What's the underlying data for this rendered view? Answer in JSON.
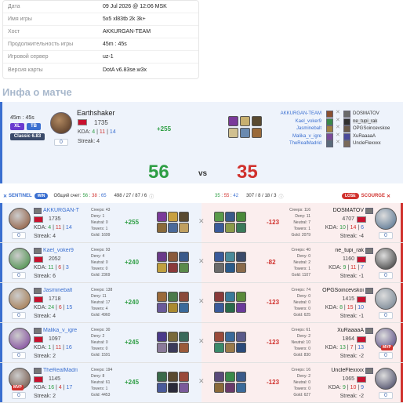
{
  "info": {
    "rows": [
      {
        "key": "Дата",
        "value": "09 Jul 2026 @ 12:06 MSK"
      },
      {
        "key": "Имя игры",
        "value": "5x5 xl83tb 2k 3k+"
      },
      {
        "key": "Хост",
        "value": "AKKURGAN-TEAM"
      },
      {
        "key": "Продолжительность игры",
        "value": "45m : 45s"
      },
      {
        "key": "Игровой сервер",
        "value": "uz-1"
      },
      {
        "key": "Версия карты",
        "value": "DotA v6.83se.w3x"
      }
    ]
  },
  "section_title": "Инфа о матче",
  "match": {
    "duration": "45m : 45s",
    "mode_xl": "XL",
    "mode_tb": "TB",
    "version": "Classic 6.83",
    "host_level": "0",
    "host_name": "Earthshaker",
    "host_rating": "1735",
    "host_kda_label": "KDA:",
    "host_kda_k": "4",
    "host_kda_d": "11",
    "host_kda_a": "14",
    "host_streak": "Streak: 4",
    "host_diff": "+255",
    "score_sentinel": "56",
    "vs": "vs",
    "score_scourge": "35",
    "team_left": [
      "AKKURGAN-TEAM",
      "Kael_voker9",
      "Jasminebalt",
      "Malika_v_igre",
      "TheRealMadrid"
    ],
    "team_right": [
      "DOSMATOV",
      "ne_tupi_rak",
      "OPGSoincevskoe",
      "XuRaaaaA",
      "UncleFlexxxx"
    ]
  },
  "team_header": {
    "sentinel": "SENTINEL",
    "win": "WIN",
    "total_label": "Общий счет:",
    "total_k": "56",
    "total_d": "38",
    "total_a": "65",
    "left_extra": "498 / 27 / 87 / 6",
    "right_score_k": "35",
    "right_score_d": "55",
    "right_score_a": "42",
    "right_extra": "307 / 8 / 18 / 3",
    "lose": "LOSE",
    "scourge": "SCOURGE"
  },
  "players": [
    {
      "left": {
        "name": "AKKURGAN-T",
        "rating": "1735",
        "k": "4",
        "d": "11",
        "a": "14",
        "streak": "Streak: 4",
        "level": "0",
        "creeps": "Creeps: 43",
        "deny": "Deny: 1",
        "neutral": "Neutral: 0",
        "towers": "Towers: 1",
        "gold": "Gold: 1699",
        "diff": "+255",
        "mvp": ""
      },
      "right": {
        "name": "DOSMATOV",
        "rating": "4707",
        "k": "10",
        "d": "14",
        "a": "6",
        "streak": "Streak: -4",
        "level": "0",
        "creeps": "Creeps: 116",
        "deny": "Deny: 11",
        "neutral": "Neutral: 7",
        "towers": "Towers: 1",
        "gold": "Gold: 2079",
        "diff": "-123",
        "mvp": ""
      }
    },
    {
      "left": {
        "name": "Kael_voker9",
        "rating": "2052",
        "k": "11",
        "d": "6",
        "a": "3",
        "streak": "Streak: 6",
        "level": "0",
        "creeps": "Creeps: 93",
        "deny": "Deny: 4",
        "neutral": "Neutral: 0",
        "towers": "Towers: 0",
        "gold": "Gold: 2369",
        "diff": "+240",
        "mvp": ""
      },
      "right": {
        "name": "ne_tupi_rak",
        "rating": "1160",
        "k": "9",
        "d": "11",
        "a": "7",
        "streak": "Streak: -1",
        "level": "0",
        "creeps": "Creeps: 40",
        "deny": "Deny: 0",
        "neutral": "Neutral: 2",
        "towers": "Towers: 1",
        "gold": "Gold: 1107",
        "diff": "-82",
        "mvp": ""
      }
    },
    {
      "left": {
        "name": "Jasminebalt",
        "rating": "1718",
        "k": "24",
        "d": "6",
        "a": "15",
        "streak": "Streak: 4",
        "level": "0",
        "creeps": "Creeps: 138",
        "deny": "Deny: 11",
        "neutral": "Neutral: 17",
        "towers": "Towers: 4",
        "gold": "Gold: 4960",
        "diff": "+240",
        "mvp": ""
      },
      "right": {
        "name": "OPGSoincevskoi",
        "rating": "1415",
        "k": "8",
        "d": "15",
        "a": "10",
        "streak": "Streak: -1",
        "level": "0",
        "creeps": "Creeps: 74",
        "deny": "Deny: 0",
        "neutral": "Neutral: 0",
        "towers": "Towers: 0",
        "gold": "Gold: 625",
        "diff": "-123",
        "mvp": ""
      }
    },
    {
      "left": {
        "name": "Malika_v_igre",
        "rating": "1097",
        "k": "1",
        "d": "11",
        "a": "16",
        "streak": "Streak: 2",
        "level": "0",
        "creeps": "Creeps: 30",
        "deny": "Deny: 2",
        "neutral": "Neutral: 0",
        "towers": "Towers: 0",
        "gold": "Gold: 1591",
        "diff": "+245",
        "mvp": ""
      },
      "right": {
        "name": "XuRaaaaA",
        "rating": "1864",
        "k": "13",
        "d": "7",
        "a": "13",
        "streak": "Streak: -2",
        "level": "0",
        "creeps": "Creeps: 61",
        "deny": "Deny: 2",
        "neutral": "Neutral: 10",
        "towers": "Towers: 0",
        "gold": "Gold: 830",
        "diff": "-123",
        "mvp": "MVP"
      }
    },
    {
      "left": {
        "name": "TheRealMadri",
        "rating": "1145",
        "k": "16",
        "d": "4",
        "a": "17",
        "streak": "Streak: 2",
        "level": "0",
        "creeps": "Creeps: 194",
        "deny": "Deny: 8",
        "neutral": "Neutral: 61",
        "towers": "Towers: 1",
        "gold": "Gold: 4453",
        "diff": "+245",
        "mvp": "MVP"
      },
      "right": {
        "name": "UncleFlexxxx",
        "rating": "1065",
        "k": "9",
        "d": "10",
        "a": "9",
        "streak": "Streak: -2",
        "level": "0",
        "creeps": "Creeps: 16",
        "deny": "Deny: 2",
        "neutral": "Neutral: 0",
        "towers": "Towers: 0",
        "gold": "Gold: 627",
        "diff": "-123",
        "mvp": ""
      }
    }
  ],
  "colors": {
    "sentinel": "#3a6fd0",
    "scourge": "#d0312d",
    "win": "#2e9e44",
    "accent": "#4a6fb0"
  }
}
